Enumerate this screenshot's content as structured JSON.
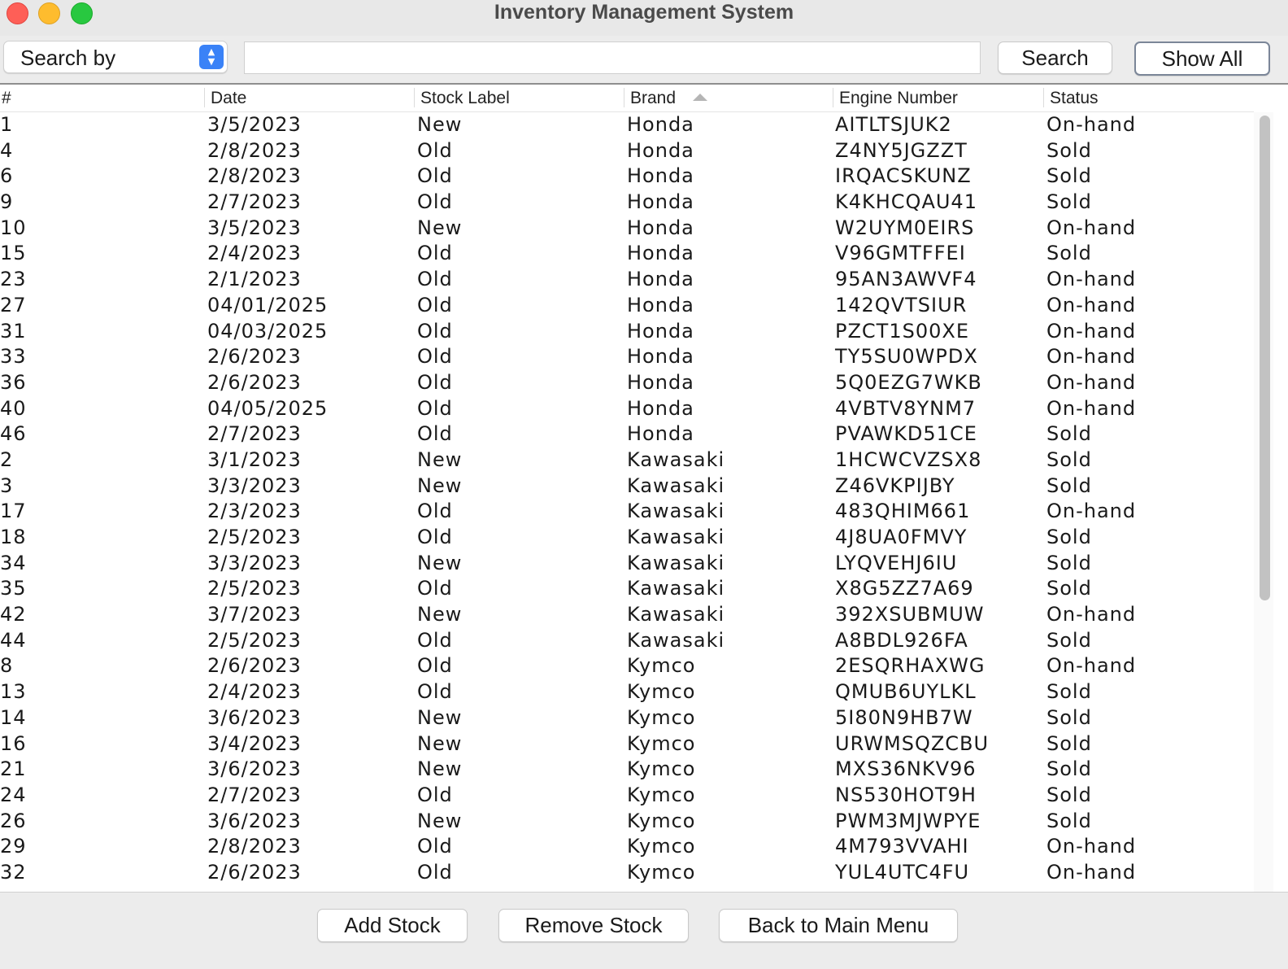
{
  "window": {
    "title": "Inventory Management System"
  },
  "toolbar": {
    "search_by_label": "Search by",
    "search_query": "",
    "search_label": "Search",
    "show_all_label": "Show All"
  },
  "table": {
    "columns": [
      "#",
      "Date",
      "Stock Label",
      "Brand",
      "Engine Number",
      "Status"
    ],
    "sorted_column": "Brand",
    "sort_direction": "ascending",
    "rows": [
      [
        "1",
        "3/5/2023",
        "New",
        "Honda",
        "AITLTSJUK2",
        "On-hand"
      ],
      [
        "4",
        "2/8/2023",
        "Old",
        "Honda",
        "Z4NY5JGZZT",
        "Sold"
      ],
      [
        "6",
        "2/8/2023",
        "Old",
        "Honda",
        "IRQACSKUNZ",
        "Sold"
      ],
      [
        "9",
        "2/7/2023",
        "Old",
        "Honda",
        "K4KHCQAU41",
        "Sold"
      ],
      [
        "10",
        "3/5/2023",
        "New",
        "Honda",
        "W2UYM0EIRS",
        "On-hand"
      ],
      [
        "15",
        "2/4/2023",
        "Old",
        "Honda",
        "V96GMTFFEI",
        "Sold"
      ],
      [
        "23",
        "2/1/2023",
        "Old",
        "Honda",
        "95AN3AWVF4",
        "On-hand"
      ],
      [
        "27",
        "04/01/2025",
        "Old",
        "Honda",
        "142QVTSIUR",
        "On-hand"
      ],
      [
        "31",
        "04/03/2025",
        "Old",
        "Honda",
        "PZCT1S00XE",
        "On-hand"
      ],
      [
        "33",
        "2/6/2023",
        "Old",
        "Honda",
        "TY5SU0WPDX",
        "On-hand"
      ],
      [
        "36",
        "2/6/2023",
        "Old",
        "Honda",
        "5Q0EZG7WKB",
        "On-hand"
      ],
      [
        "40",
        "04/05/2025",
        "Old",
        "Honda",
        "4VBTV8YNM7",
        "On-hand"
      ],
      [
        "46",
        "2/7/2023",
        "Old",
        "Honda",
        "PVAWKD51CE",
        "Sold"
      ],
      [
        "2",
        "3/1/2023",
        "New",
        "Kawasaki",
        "1HCWCVZSX8",
        "Sold"
      ],
      [
        "3",
        "3/3/2023",
        "New",
        "Kawasaki",
        "Z46VKPIJBY",
        "Sold"
      ],
      [
        "17",
        "2/3/2023",
        "Old",
        "Kawasaki",
        "483QHIM661",
        "On-hand"
      ],
      [
        "18",
        "2/5/2023",
        "Old",
        "Kawasaki",
        "4J8UA0FMVY",
        "Sold"
      ],
      [
        "34",
        "3/3/2023",
        "New",
        "Kawasaki",
        "LYQVEHJ6IU",
        "Sold"
      ],
      [
        "35",
        "2/5/2023",
        "Old",
        "Kawasaki",
        "X8G5ZZ7A69",
        "Sold"
      ],
      [
        "42",
        "3/7/2023",
        "New",
        "Kawasaki",
        "392XSUBMUW",
        "On-hand"
      ],
      [
        "44",
        "2/5/2023",
        "Old",
        "Kawasaki",
        "A8BDL926FA",
        "Sold"
      ],
      [
        "8",
        "2/6/2023",
        "Old",
        "Kymco",
        "2ESQRHAXWG",
        "On-hand"
      ],
      [
        "13",
        "2/4/2023",
        "Old",
        "Kymco",
        "QMUB6UYLKL",
        "Sold"
      ],
      [
        "14",
        "3/6/2023",
        "New",
        "Kymco",
        "5I80N9HB7W",
        "Sold"
      ],
      [
        "16",
        "3/4/2023",
        "New",
        "Kymco",
        "URWMSQZCBU",
        "Sold"
      ],
      [
        "21",
        "3/6/2023",
        "New",
        "Kymco",
        "MXS36NKV96",
        "Sold"
      ],
      [
        "24",
        "2/7/2023",
        "Old",
        "Kymco",
        "NS530HOT9H",
        "Sold"
      ],
      [
        "26",
        "3/6/2023",
        "New",
        "Kymco",
        "PWM3MJWPYE",
        "Sold"
      ],
      [
        "29",
        "2/8/2023",
        "Old",
        "Kymco",
        "4M793VVAHI",
        "On-hand"
      ],
      [
        "32",
        "2/6/2023",
        "Old",
        "Kymco",
        "YUL4UTC4FU",
        "On-hand"
      ]
    ]
  },
  "footer": {
    "add_label": "Add Stock",
    "remove_label": "Remove Stock",
    "back_label": "Back to Main Menu"
  },
  "icons": {
    "close": "traffic-close-icon",
    "minimize": "traffic-minimize-icon",
    "maximize": "traffic-maximize-icon",
    "select_arrows": "updown-chevron-icon",
    "sort": "sort-ascending-icon"
  },
  "colors": {
    "close": "#fe5f57",
    "minimize": "#febc2e",
    "maximize": "#28c840",
    "accent": "#3a82f7"
  }
}
